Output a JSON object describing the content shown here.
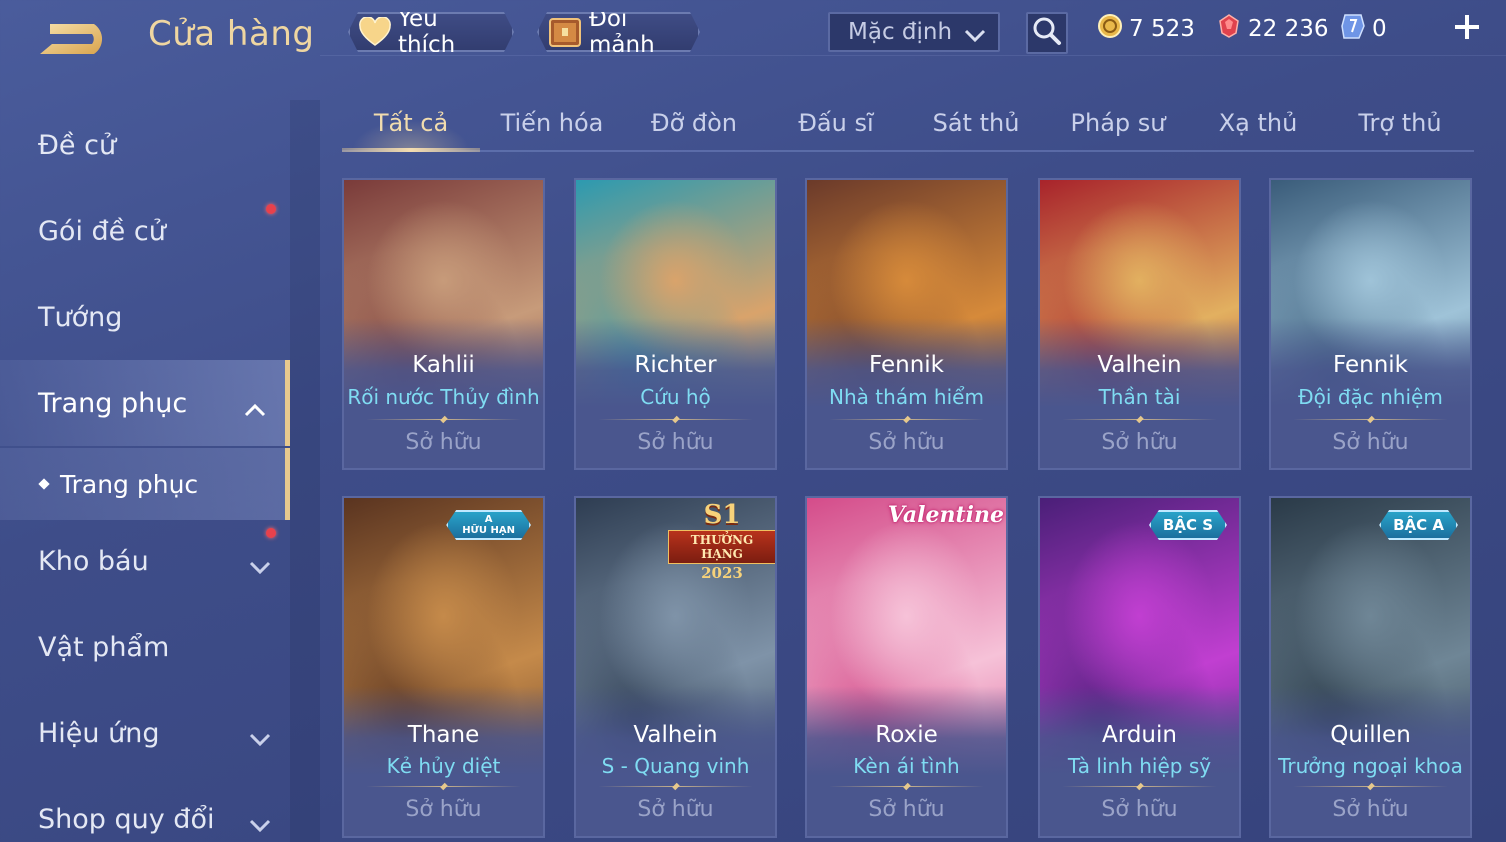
{
  "header": {
    "title": "Cửa hàng",
    "favorites_label": "Yêu thích",
    "shard_exchange_label": "Đổi mảnh",
    "sort_value": "Mặc định",
    "currencies": [
      {
        "name": "gold",
        "value": "7 523",
        "color": "#e9b84a"
      },
      {
        "name": "voucher",
        "value": "22 236",
        "color": "#e0424d"
      },
      {
        "name": "ticket",
        "value": "0",
        "color": "#8fb4ff"
      }
    ]
  },
  "sidebar": {
    "items": [
      {
        "label": "Đề cử",
        "has_arrow": false,
        "dot": false
      },
      {
        "label": "Gói đề cử",
        "has_arrow": false,
        "dot": true
      },
      {
        "label": "Tướng",
        "has_arrow": false,
        "dot": false
      },
      {
        "label": "Trang phục",
        "has_arrow": true,
        "expanded": true,
        "active": true,
        "dot": false
      },
      {
        "label": "Kho báu",
        "has_arrow": true,
        "dot": true
      },
      {
        "label": "Vật phẩm",
        "has_arrow": false,
        "dot": false
      },
      {
        "label": "Hiệu ứng",
        "has_arrow": true,
        "dot": false
      },
      {
        "label": "Shop quy đổi",
        "has_arrow": true,
        "dot": false
      }
    ],
    "sub_item": "Trang phục"
  },
  "tabs": [
    "Tất cả",
    "Tiến hóa",
    "Đỡ đòn",
    "Đấu sĩ",
    "Sát thủ",
    "Pháp sư",
    "Xạ thủ",
    "Trợ thủ"
  ],
  "active_tab": "Tất cả",
  "cards": [
    {
      "hero": "Kahlii",
      "skin": "Rối nước Thủy đình",
      "status": "Sở hữu",
      "tint": [
        "#7a3b3a",
        "#c79b7a"
      ]
    },
    {
      "hero": "Richter",
      "skin": "Cứu hộ",
      "status": "Sở hữu",
      "tint": [
        "#2c9ab0",
        "#d9a36b"
      ]
    },
    {
      "hero": "Fennik",
      "skin": "Nhà thám hiểm",
      "status": "Sở hữu",
      "tint": [
        "#6b3a2a",
        "#d68a3a"
      ]
    },
    {
      "hero": "Valhein",
      "skin": "Thần tài",
      "status": "Sở hữu",
      "tint": [
        "#a8232b",
        "#e2b060"
      ]
    },
    {
      "hero": "Fennik",
      "skin": "Đội đặc nhiệm",
      "status": "Sở hữu",
      "tint": [
        "#3a5c7a",
        "#9fc3d8"
      ]
    },
    {
      "hero": "Thane",
      "skin": "Kẻ hủy diệt",
      "status": "Sở hữu",
      "tint": [
        "#5a3420",
        "#c58a4a"
      ],
      "badge": {
        "top": "A",
        "bottom": "HỮU HẠN"
      }
    },
    {
      "hero": "Valhein",
      "skin": "S - Quang vinh",
      "status": "Sở hữu",
      "tint": [
        "#2e3d52",
        "#7f93a8"
      ],
      "rank": {
        "s": "S1",
        "label": "THƯỞNG HẠNG",
        "year": "2023"
      }
    },
    {
      "hero": "Roxie",
      "skin": "Kèn ái tình",
      "status": "Sở hữu",
      "tint": [
        "#d44c8a",
        "#f6c2d8"
      ],
      "tag": "Valentine"
    },
    {
      "hero": "Arduin",
      "skin": "Tà linh hiệp sỹ",
      "status": "Sở hữu",
      "tint": [
        "#4a1f78",
        "#c13fd1"
      ],
      "badge_text": "BẬC S"
    },
    {
      "hero": "Quillen",
      "skin": "Trưởng ngoại khoa",
      "status": "Sở hữu",
      "tint": [
        "#2a3a48",
        "#6f8696"
      ],
      "badge_text": "BẬC A"
    }
  ]
}
